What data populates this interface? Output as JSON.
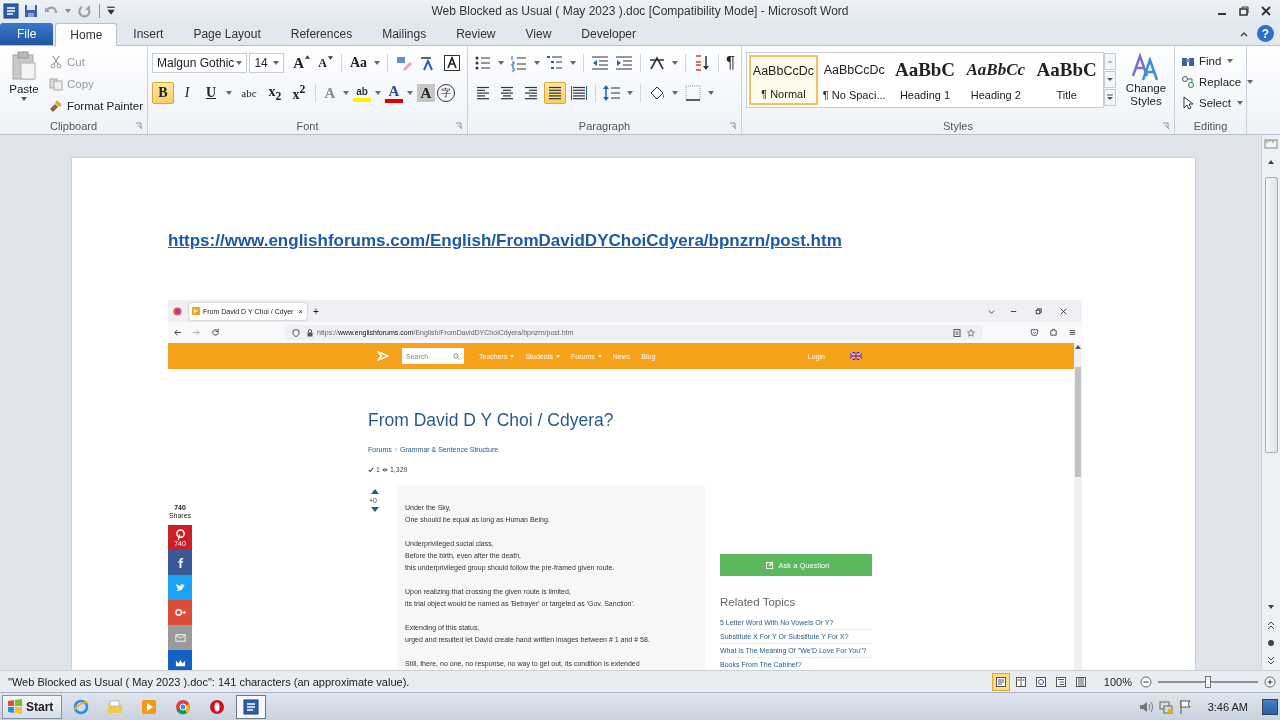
{
  "title_bar": {
    "title": "Web Blocked as Usual ( May 2023 ).doc [Compatibility Mode]  -  Microsoft Word"
  },
  "ribbon_tabs": [
    {
      "label": "File",
      "kind": "file",
      "selected": false
    },
    {
      "label": "Home",
      "kind": "tab",
      "selected": true
    },
    {
      "label": "Insert",
      "kind": "tab",
      "selected": false
    },
    {
      "label": "Page Layout",
      "kind": "tab",
      "selected": false
    },
    {
      "label": "References",
      "kind": "tab",
      "selected": false
    },
    {
      "label": "Mailings",
      "kind": "tab",
      "selected": false
    },
    {
      "label": "Review",
      "kind": "tab",
      "selected": false
    },
    {
      "label": "View",
      "kind": "tab",
      "selected": false
    },
    {
      "label": "Developer",
      "kind": "tab",
      "selected": false
    }
  ],
  "help": "?",
  "clipboard": {
    "label": "Clipboard",
    "paste": "Paste",
    "items": [
      {
        "label": "Cut",
        "kind": "cut",
        "disabled": true
      },
      {
        "label": "Copy",
        "kind": "copy",
        "disabled": true
      },
      {
        "label": "Format Painter",
        "kind": "painter",
        "disabled": false
      }
    ]
  },
  "font": {
    "label": "Font",
    "name": "Malgun Gothic",
    "size": "14",
    "grow": "A",
    "shrink": "A",
    "change_case": "Aa",
    "format_buttons": [
      {
        "glyph": "B",
        "kind": "bold",
        "on": true
      },
      {
        "glyph": "I",
        "kind": "italic",
        "on": false
      },
      {
        "glyph": "U",
        "kind": "underline",
        "on": false
      },
      {
        "glyph": "abc",
        "kind": "strike",
        "on": false
      },
      {
        "glyph": "x$_{2}$",
        "kind": "sub",
        "on": false
      },
      {
        "glyph": "x$^{2}$",
        "kind": "sup",
        "on": false
      }
    ],
    "effects": [
      {
        "glyph": "A",
        "kind": "text-effects"
      },
      {
        "glyph": "ab",
        "kind": "highlight"
      },
      {
        "glyph": "A",
        "kind": "font-color"
      },
      {
        "glyph": "A",
        "kind": "shading"
      },
      {
        "glyph": "字",
        "kind": "enclose"
      }
    ]
  },
  "paragraph": {
    "label": "Paragraph",
    "show_marks": "¶",
    "alignment": [
      {
        "kind": "left",
        "selected": false
      },
      {
        "kind": "center",
        "selected": false
      },
      {
        "kind": "right",
        "selected": false
      },
      {
        "kind": "justify",
        "selected": true
      },
      {
        "kind": "distributed",
        "selected": false
      }
    ]
  },
  "styles": {
    "label": "Styles",
    "change_styles": "Change Styles",
    "gallery": [
      {
        "preview": "AaBbCcDc",
        "name": "¶ Normal",
        "kind": "normal",
        "selected": true
      },
      {
        "preview": "AaBbCcDc",
        "name": "¶ No Spaci...",
        "kind": "normal",
        "selected": false
      },
      {
        "preview": "AaBbC",
        "name": "Heading 1",
        "kind": "heading1",
        "selected": false
      },
      {
        "preview": "AaBbCc",
        "name": "Heading 2",
        "kind": "heading2",
        "selected": false
      },
      {
        "preview": "AaBbC",
        "name": "Title",
        "kind": "title",
        "selected": false
      }
    ]
  },
  "editing": {
    "label": "Editing",
    "items": [
      {
        "label": "Find",
        "kind": "find"
      },
      {
        "label": "Replace",
        "kind": "replace"
      },
      {
        "label": "Select",
        "kind": "select"
      }
    ]
  },
  "document": {
    "link": "https://www.englishforums.com/English/FromDavidDYChoiCdyera/bpnzrn/post.htm",
    "browser": {
      "tab_title": "From David D Y Choi / Cdyer",
      "tab_close": "×",
      "new_tab": "+",
      "url": "https://**www.englishforums.com**/English/FromDavidDYChoiCdyera/bpnzrn/post.htm",
      "search_placeholder": "Search",
      "nav": [
        {
          "label": "Teachers",
          "dropdown": true
        },
        {
          "label": "Students",
          "dropdown": true
        },
        {
          "label": "Forums",
          "dropdown": true
        },
        {
          "label": "News",
          "dropdown": false
        },
        {
          "label": "Blog",
          "dropdown": false
        }
      ],
      "login": "Login",
      "title": "From David D Y Choi / Cdyera?",
      "breadcrumb": [
        "Forums",
        "Grammar & Sentence Structure"
      ],
      "breadcrumb_separator": "›",
      "answers": "1",
      "views": "1,329",
      "votes": "+0",
      "paragraphs": [
        [
          "Under the Sky,",
          "One should be equal as long as Human Being."
        ],
        [
          "Underprivileged social class,",
          "Before the birth, even after the death,",
          "this underprivileged group should follow the pre-framed given route."
        ],
        [
          "Upon realizing that crossing the given route is limited,",
          "its trial object would be named as 'Betrayer' or targeted as 'Gov. Sanction'."
        ],
        [
          "Extending of this status,",
          "urged and resulted let David create hand written images between # 1 and # 58."
        ],
        [
          "Still, there, no one, no response, no way to get out, its condition is extended"
        ]
      ],
      "share_count": "740",
      "share_label": "Shares",
      "share_buttons": [
        {
          "kind": "pinterest",
          "count": "740"
        },
        {
          "kind": "facebook"
        },
        {
          "kind": "twitter"
        },
        {
          "kind": "google"
        },
        {
          "kind": "email"
        },
        {
          "kind": "crown"
        }
      ],
      "ask": "Ask a Question",
      "related_title": "Related Topics",
      "related": [
        "5 Letter Word With No Vowels Or Y?",
        "Substitute X For Y Or Substitute Y For X?",
        "What Is The Meaning Of \"We'D Love For You\"?",
        "Books From The Cabinet?"
      ]
    }
  },
  "status_bar": {
    "text": "\"Web Blocked as Usual ( May 2023 ).doc\": 141 characters (an approximate value).",
    "views": [
      {
        "kind": "print",
        "selected": true
      },
      {
        "kind": "reading",
        "selected": false
      },
      {
        "kind": "web",
        "selected": false
      },
      {
        "kind": "outline",
        "selected": false
      },
      {
        "kind": "draft",
        "selected": false
      }
    ],
    "zoom": {
      "label": "100%",
      "level": 0.5
    }
  },
  "taskbar": {
    "start": "Start",
    "clock": "3:46 AM",
    "apps": [
      {
        "kind": "ie",
        "selected": false
      },
      {
        "kind": "folder",
        "selected": false
      },
      {
        "kind": "media",
        "selected": false
      },
      {
        "kind": "chrome",
        "selected": false
      },
      {
        "kind": "opera",
        "selected": false
      },
      {
        "kind": "word",
        "selected": true
      }
    ]
  }
}
